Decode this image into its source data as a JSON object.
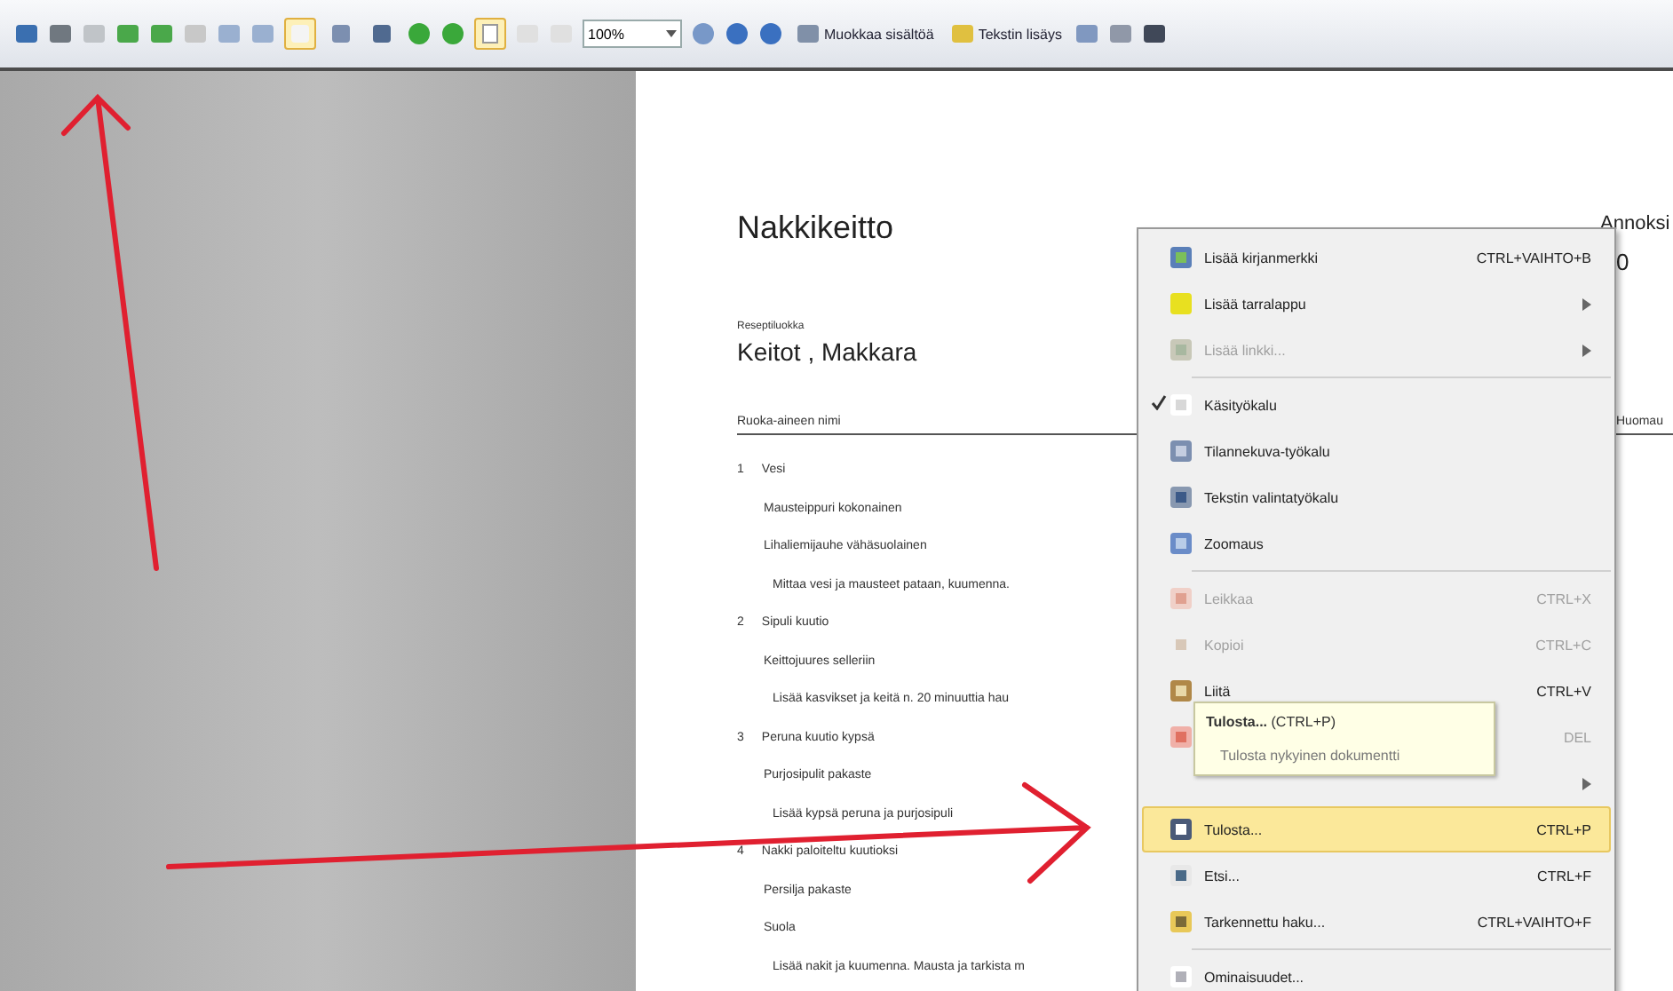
{
  "toolbar": {
    "tools": [
      {
        "selected": true
      },
      {
        "selected": false
      },
      {
        "selected": false
      }
    ],
    "fit_page": {
      "selected": true
    },
    "zoom": "100%",
    "buttons": [
      "Muokkaa sisältöä",
      "Tekstin lisäys"
    ]
  },
  "document": {
    "title": "Nakkikeitto",
    "right_fragments": [
      "Annoksi",
      "0"
    ],
    "category_label": "Reseptiluokka",
    "category": "Keitot , Makkara",
    "column_header": "Ruoka-aineen nimi",
    "column_header_right": "Huomau",
    "steps": [
      {
        "number": "1",
        "lines": [
          "Vesi",
          "Mausteippuri kokonainen",
          "Lihaliemijauhe vähäsuolainen"
        ],
        "instruction": "Mittaa vesi ja mausteet pataan, kuumenna."
      },
      {
        "number": "2",
        "lines": [
          "Sipuli kuutio",
          "Keittojuures selleriin"
        ],
        "instruction": "Lisää kasvikset ja keitä n. 20 minuuttia hau"
      },
      {
        "number": "3",
        "lines": [
          "Peruna kuutio kypsä",
          "Purjosipulit pakaste"
        ],
        "instruction": "Lisää kypsä peruna ja purjosipuli"
      },
      {
        "number": "4",
        "lines": [
          "Nakki paloiteltu kuutioksi",
          "Persilja pakaste",
          "Suola"
        ],
        "instruction": "Lisää nakit ja kuumenna. Mausta ja tarkista m"
      }
    ]
  },
  "context_menu": [
    {
      "kind": "item",
      "label": "Lisää kirjanmerkki",
      "shortcut": "CTRL+VAIHTO+B",
      "submenu": false,
      "disabled": false,
      "checked": false,
      "selected": false
    },
    {
      "kind": "item",
      "label": "Lisää tarralappu",
      "submenu": true,
      "disabled": false,
      "checked": false,
      "selected": false
    },
    {
      "kind": "item",
      "label": "Lisää linkki...",
      "submenu": true,
      "disabled": true,
      "checked": false,
      "selected": false
    },
    {
      "kind": "separator"
    },
    {
      "kind": "item",
      "label": "Käsityökalu",
      "submenu": false,
      "disabled": false,
      "checked": true,
      "selected": false
    },
    {
      "kind": "item",
      "label": "Tilannekuva-työkalu",
      "submenu": false,
      "disabled": false,
      "checked": false,
      "selected": false
    },
    {
      "kind": "item",
      "label": "Tekstin valintatyökalu",
      "submenu": false,
      "disabled": false,
      "checked": false,
      "selected": false
    },
    {
      "kind": "item",
      "label": "Zoomaus",
      "submenu": false,
      "disabled": false,
      "checked": false,
      "selected": false
    },
    {
      "kind": "separator"
    },
    {
      "kind": "item",
      "label": "Leikkaa",
      "shortcut": "CTRL+X",
      "submenu": false,
      "disabled": true,
      "checked": false,
      "selected": false
    },
    {
      "kind": "item",
      "label": "Kopioi",
      "shortcut": "CTRL+C",
      "submenu": false,
      "disabled": true,
      "checked": false,
      "selected": false
    },
    {
      "kind": "item",
      "label": "Liitä",
      "shortcut": "CTRL+V",
      "submenu": false,
      "disabled": false,
      "checked": false,
      "selected": false
    },
    {
      "kind": "item",
      "shortcut": "DEL",
      "submenu": false,
      "disabled": true,
      "checked": false,
      "selected": false
    },
    {
      "kind": "item",
      "submenu": true,
      "disabled": false,
      "checked": false,
      "selected": false
    },
    {
      "kind": "item",
      "label": "Tulosta...",
      "shortcut": "CTRL+P",
      "submenu": false,
      "disabled": false,
      "checked": false,
      "selected": true
    },
    {
      "kind": "item",
      "label": "Etsi...",
      "shortcut": "CTRL+F",
      "submenu": false,
      "disabled": false,
      "checked": false,
      "selected": false
    },
    {
      "kind": "item",
      "label": "Tarkennettu haku...",
      "shortcut": "CTRL+VAIHTO+F",
      "submenu": false,
      "disabled": false,
      "checked": false,
      "selected": false
    },
    {
      "kind": "separator"
    },
    {
      "kind": "item",
      "label": "Ominaisuudet...",
      "submenu": false,
      "disabled": false,
      "checked": false,
      "selected": false
    }
  ],
  "tooltip": {
    "title": "Tulosta...",
    "shortcut": "(CTRL+P)",
    "description": "Tulosta nykyinen dokumentti"
  }
}
